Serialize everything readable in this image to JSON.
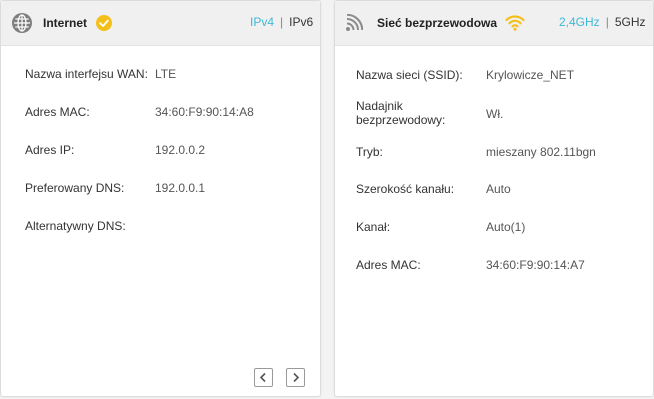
{
  "internet": {
    "title": "Internet",
    "status_icon": "check-circle-icon",
    "status_color": "#f5bf1a",
    "ip_tabs": [
      "IPv4",
      "IPv6"
    ],
    "ip_tab_active": "IPv4",
    "rows": [
      {
        "label": "Nazwa interfejsu WAN:",
        "value": "LTE"
      },
      {
        "label": "Adres MAC:",
        "value": "34:60:F9:90:14:A8"
      },
      {
        "label": "Adres IP:",
        "value": "192.0.0.2"
      },
      {
        "label": "Preferowany DNS:",
        "value": "192.0.0.1"
      },
      {
        "label": "Alternatywny DNS:",
        "value": ""
      }
    ],
    "nav": {
      "prev_icon": "chevron-left-icon",
      "next_icon": "chevron-right-icon"
    }
  },
  "wireless": {
    "title": "Sieć bezprzewodowa",
    "status_icon": "wifi-icon",
    "status_color": "#f5bf1a",
    "bands": [
      "2,4GHz",
      "5GHz"
    ],
    "band_active": "2,4GHz",
    "rows": [
      {
        "label": "Nazwa sieci (SSID):",
        "value": "Krylowicze_NET"
      },
      {
        "label": "Nadajnik\nbezprzewodowy:",
        "value": "Wł."
      },
      {
        "label": "Tryb:",
        "value": "mieszany 802.11bgn"
      },
      {
        "label": "Szerokość kanału:",
        "value": "Auto"
      },
      {
        "label": "Kanał:",
        "value": "Auto(1)"
      },
      {
        "label": "Adres MAC:",
        "value": "34:60:F9:90:14:A7"
      }
    ]
  },
  "accent_color": "#3fb8d6"
}
